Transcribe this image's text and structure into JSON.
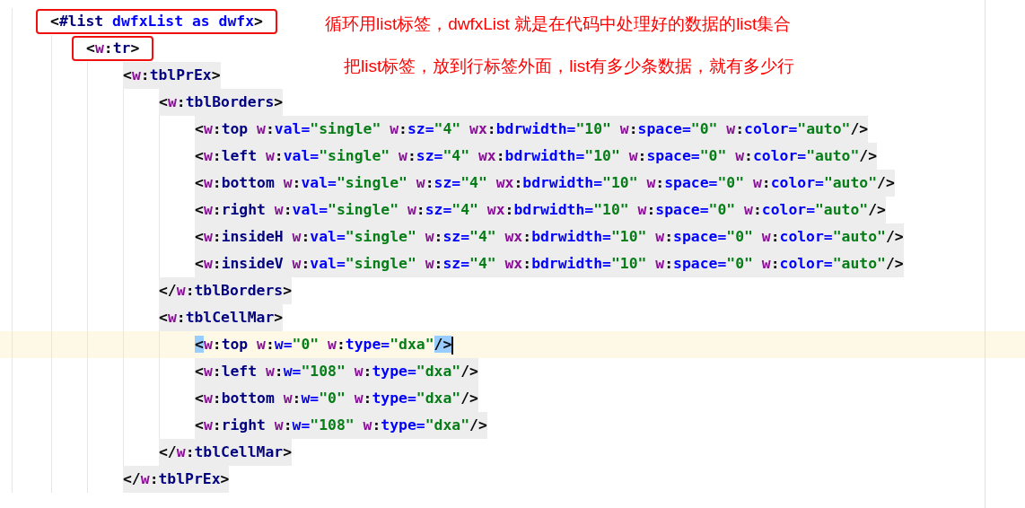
{
  "editor": {
    "lines": [
      {
        "text": "<#list dwfxList as dwfx>",
        "boxed": true,
        "current": false,
        "children": [
          {
            "text": "<w:tr>",
            "boxed": true,
            "current": false,
            "children": [
              {
                "text": "<w:tblPrEx>",
                "boxed": false,
                "current": false,
                "children": [
                  {
                    "text": "<w:tblBorders>",
                    "boxed": false,
                    "current": false,
                    "children": [
                      {
                        "text": "<w:top w:val=\"single\" w:sz=\"4\" wx:bdrwidth=\"10\" w:space=\"0\" w:color=\"auto\"/>",
                        "boxed": false,
                        "current": false
                      },
                      {
                        "text": "<w:left w:val=\"single\" w:sz=\"4\" wx:bdrwidth=\"10\" w:space=\"0\" w:color=\"auto\"/>",
                        "boxed": false,
                        "current": false
                      },
                      {
                        "text": "<w:bottom w:val=\"single\" w:sz=\"4\" wx:bdrwidth=\"10\" w:space=\"0\" w:color=\"auto\"/>",
                        "boxed": false,
                        "current": false
                      },
                      {
                        "text": "<w:right w:val=\"single\" w:sz=\"4\" wx:bdrwidth=\"10\" w:space=\"0\" w:color=\"auto\"/>",
                        "boxed": false,
                        "current": false
                      },
                      {
                        "text": "<w:insideH w:val=\"single\" w:sz=\"4\" wx:bdrwidth=\"10\" w:space=\"0\" w:color=\"auto\"/>",
                        "boxed": false,
                        "current": false
                      },
                      {
                        "text": "<w:insideV w:val=\"single\" w:sz=\"4\" wx:bdrwidth=\"10\" w:space=\"0\" w:color=\"auto\"/>",
                        "boxed": false,
                        "current": false
                      }
                    ]
                  },
                  {
                    "text": "</w:tblBorders>",
                    "boxed": false,
                    "current": false
                  },
                  {
                    "text": "<w:tblCellMar>",
                    "boxed": false,
                    "current": false,
                    "children": [
                      {
                        "text": "<w:top w:w=\"0\" w:type=\"dxa\"/>",
                        "boxed": false,
                        "current": true
                      },
                      {
                        "text": "<w:left w:w=\"108\" w:type=\"dxa\"/>",
                        "boxed": false,
                        "current": false
                      },
                      {
                        "text": "<w:bottom w:w=\"0\" w:type=\"dxa\"/>",
                        "boxed": false,
                        "current": false
                      },
                      {
                        "text": "<w:right w:w=\"108\" w:type=\"dxa\"/>",
                        "boxed": false,
                        "current": false
                      }
                    ]
                  },
                  {
                    "text": "</w:tblCellMar>",
                    "boxed": false,
                    "current": false
                  }
                ]
              },
              {
                "text": "</w:tblPrEx>",
                "boxed": false,
                "current": false
              }
            ]
          }
        ]
      }
    ]
  },
  "annotations": [
    "循环用list标签，dwfxList 就是在代码中处理好的数据的list集合",
    "把list标签，放到行标签外面，list有多少条数据，就有多少行"
  ]
}
